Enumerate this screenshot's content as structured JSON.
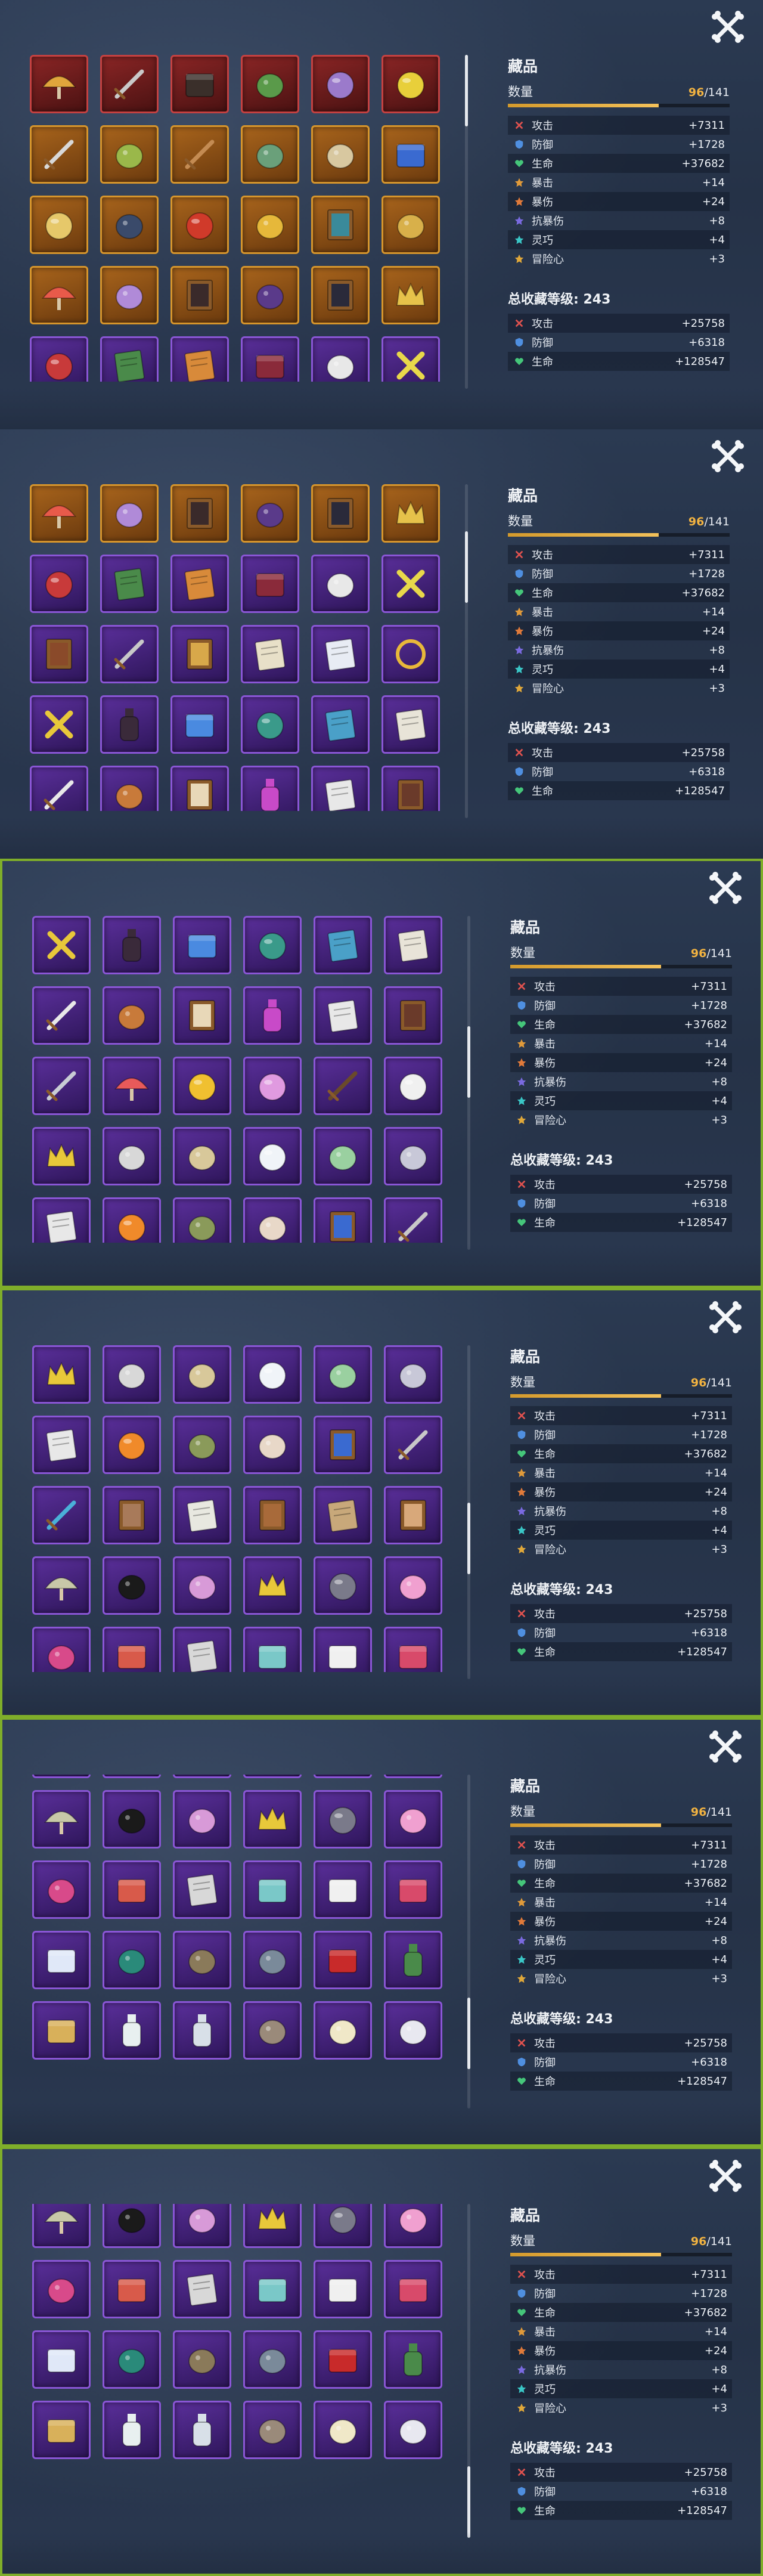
{
  "stats": {
    "title": "藏品",
    "quantity_label": "数量",
    "quantity_current": "96",
    "quantity_total": "/141",
    "quantity_fraction": 0.68,
    "attributes": [
      {
        "name": "攻击",
        "value": "+7311",
        "icon": "attack-icon",
        "color": "#e0524f"
      },
      {
        "name": "防御",
        "value": "+1728",
        "icon": "defense-icon",
        "color": "#4f8fe0"
      },
      {
        "name": "生命",
        "value": "+37682",
        "icon": "life-icon",
        "color": "#45c67a"
      },
      {
        "name": "暴击",
        "value": "+14",
        "icon": "crit-icon",
        "color": "#e09a3a"
      },
      {
        "name": "暴伤",
        "value": "+24",
        "icon": "crit-damage-icon",
        "color": "#e07a3a"
      },
      {
        "name": "抗暴伤",
        "value": "+8",
        "icon": "crit-resist-icon",
        "color": "#7a6ae0"
      },
      {
        "name": "灵巧",
        "value": "+4",
        "icon": "agility-icon",
        "color": "#3ac6c6"
      },
      {
        "name": "冒险心",
        "value": "+3",
        "icon": "adventure-icon",
        "color": "#e0a83a"
      }
    ],
    "level_label": "总收藏等级:",
    "level_value": "243",
    "level_bonus": [
      {
        "name": "攻击",
        "value": "+25758",
        "icon": "attack-icon",
        "color": "#e0524f"
      },
      {
        "name": "防御",
        "value": "+6318",
        "icon": "defense-icon",
        "color": "#4f8fe0"
      },
      {
        "name": "生命",
        "value": "+128547",
        "icon": "life-icon",
        "color": "#45c67a"
      }
    ]
  },
  "collection_rows": [
    {
      "rarity": "red",
      "items": [
        {
          "icon": "straw-hat-icon",
          "color": "#e0a53c"
        },
        {
          "icon": "twin-swords-icon",
          "color": "#c9c9c9"
        },
        {
          "icon": "briefcase-icon",
          "color": "#3a2f2a"
        },
        {
          "icon": "green-figure-icon",
          "color": "#5a9a4a"
        },
        {
          "icon": "purple-snail-icon",
          "color": "#9b7acb"
        },
        {
          "icon": "yellow-fruit-icon",
          "color": "#e8cf3a"
        }
      ]
    },
    {
      "rarity": "gold",
      "items": [
        {
          "icon": "curved-sword-icon",
          "color": "#d8d8d8"
        },
        {
          "icon": "slingshot-icon",
          "color": "#9ab84a"
        },
        {
          "icon": "wooden-sword-icon",
          "color": "#c48b52"
        },
        {
          "icon": "stone-statue-icon",
          "color": "#6aa07a"
        },
        {
          "icon": "fossil-shell-icon",
          "color": "#d8c8a0"
        },
        {
          "icon": "blue-box-icon",
          "color": "#3a6ad0"
        }
      ]
    },
    {
      "rarity": "gold",
      "items": [
        {
          "icon": "snail-icon",
          "color": "#e6c86a"
        },
        {
          "icon": "phone-icon",
          "color": "#3a4a6a"
        },
        {
          "icon": "red-apple-icon",
          "color": "#d03a2a"
        },
        {
          "icon": "gold-pile-icon",
          "color": "#e6b83a"
        },
        {
          "icon": "painting-icon",
          "color": "#3a8a9a"
        },
        {
          "icon": "gold-scroll-icon",
          "color": "#d8b04a"
        }
      ]
    },
    {
      "rarity": "gold",
      "items": [
        {
          "icon": "mushroom-icon",
          "color": "#e85a4a"
        },
        {
          "icon": "purple-shell-icon",
          "color": "#b08ad8"
        },
        {
          "icon": "portrait-icon",
          "color": "#3a2a2a"
        },
        {
          "icon": "den-den-mushi-icon",
          "color": "#5a3a8a"
        },
        {
          "icon": "framed-picture-icon",
          "color": "#2a2a3a"
        },
        {
          "icon": "golden-crown-pile-icon",
          "color": "#e6c24a"
        }
      ]
    },
    {
      "rarity": "purple",
      "items": [
        {
          "icon": "red-skull-ball-icon",
          "color": "#c83a3a"
        },
        {
          "icon": "green-book-icon",
          "color": "#4a8a4a"
        },
        {
          "icon": "manga-book-icon",
          "color": "#d88a3a"
        },
        {
          "icon": "jewel-case-icon",
          "color": "#8a2a3a"
        },
        {
          "icon": "jolly-roger-icon",
          "color": "#e8e8e8"
        },
        {
          "icon": "gold-cross-icon",
          "color": "#e8d84a"
        }
      ]
    },
    {
      "rarity": "purple",
      "items": [
        {
          "icon": "photo-frame-icon",
          "color": "#8a4a2a"
        },
        {
          "icon": "knife-icon",
          "color": "#c8c8c8"
        },
        {
          "icon": "gold-frame-icon",
          "color": "#d8a84a"
        },
        {
          "icon": "map-paper-icon",
          "color": "#e8e0c8"
        },
        {
          "icon": "blue-note-icon",
          "color": "#e8ecf4"
        },
        {
          "icon": "gold-ring-icon",
          "color": "#e8b83a"
        }
      ]
    },
    {
      "rarity": "purple",
      "items": [
        {
          "icon": "yellow-cross-icon",
          "color": "#e8c83a"
        },
        {
          "icon": "glasses-icon",
          "color": "#3a2a3a"
        },
        {
          "icon": "blue-cube-icon",
          "color": "#4a8ae0"
        },
        {
          "icon": "globe-icon",
          "color": "#3a9a8a"
        },
        {
          "icon": "world-map-icon",
          "color": "#4aa0c8"
        },
        {
          "icon": "letter-icon",
          "color": "#e8e4d8"
        }
      ]
    },
    {
      "rarity": "purple",
      "items": [
        {
          "icon": "feather-quill-icon",
          "color": "#e8e8e8"
        },
        {
          "icon": "maraca-icon",
          "color": "#c87a3a"
        },
        {
          "icon": "wanted-poster-icon",
          "color": "#e8d8b8"
        },
        {
          "icon": "perfume-bottle-icon",
          "color": "#c84ac8"
        },
        {
          "icon": "sheet-music-icon",
          "color": "#e8e8e8"
        },
        {
          "icon": "dark-frame-icon",
          "color": "#6a3a2a"
        }
      ]
    },
    {
      "rarity": "purple",
      "items": [
        {
          "icon": "scalpel-icon",
          "color": "#c8ccd4"
        },
        {
          "icon": "umbrella-icon",
          "color": "#e85a5a"
        },
        {
          "icon": "golden-ball-icon",
          "color": "#f0c030"
        },
        {
          "icon": "pink-orb-icon",
          "color": "#e09ae0"
        },
        {
          "icon": "staff-icon",
          "color": "#6a4a2a"
        },
        {
          "icon": "white-ball-icon",
          "color": "#f0f0f0"
        }
      ]
    },
    {
      "rarity": "purple",
      "items": [
        {
          "icon": "gold-crown-icon",
          "color": "#e8c83a"
        },
        {
          "icon": "whistle-icon",
          "color": "#d8d8d8"
        },
        {
          "icon": "money-bag-icon",
          "color": "#d8c89a"
        },
        {
          "icon": "white-plate-icon",
          "color": "#f0f4f8"
        },
        {
          "icon": "key-icon",
          "color": "#9ad0a0"
        },
        {
          "icon": "mirror-icon",
          "color": "#c8c8d8"
        }
      ]
    },
    {
      "rarity": "purple",
      "items": [
        {
          "icon": "document-icon",
          "color": "#e8e8e8"
        },
        {
          "icon": "orange-icon",
          "color": "#f08a2a"
        },
        {
          "icon": "sack-icon",
          "color": "#8a9a5a"
        },
        {
          "icon": "drum-stand-icon",
          "color": "#e8d8c8"
        },
        {
          "icon": "poster-icon",
          "color": "#3a6ad0"
        },
        {
          "icon": "wand-icon",
          "color": "#c8c8c8"
        }
      ]
    },
    {
      "rarity": "purple",
      "items": [
        {
          "icon": "blue-rod-icon",
          "color": "#4ab0d8"
        },
        {
          "icon": "photo-album-icon",
          "color": "#a87a5a"
        },
        {
          "icon": "paper-note-icon",
          "color": "#e8e8e0"
        },
        {
          "icon": "small-frame-icon",
          "color": "#a86a3a"
        },
        {
          "icon": "treasure-map-icon",
          "color": "#c8a87a"
        },
        {
          "icon": "character-card-icon",
          "color": "#d8a87a"
        }
      ]
    },
    {
      "rarity": "purple",
      "items": [
        {
          "icon": "parasol-icon",
          "color": "#c8c8a8"
        },
        {
          "icon": "black-fur-icon",
          "color": "#1a1a1a"
        },
        {
          "icon": "hand-mirror-icon",
          "color": "#d89ad8"
        },
        {
          "icon": "crown-necklace-icon",
          "color": "#e8c83a"
        },
        {
          "icon": "iron-ball-icon",
          "color": "#7a7a8a"
        },
        {
          "icon": "pink-creature-icon",
          "color": "#f0a0d0"
        }
      ]
    },
    {
      "rarity": "purple",
      "items": [
        {
          "icon": "toy-ship-icon",
          "color": "#d84a8a"
        },
        {
          "icon": "striped-box-icon",
          "color": "#d85a4a"
        },
        {
          "icon": "newspaper-icon",
          "color": "#d8d8d8"
        },
        {
          "icon": "capsule-icon",
          "color": "#7ac8c8"
        },
        {
          "icon": "white-tray-icon",
          "color": "#f0f0f0"
        },
        {
          "icon": "pink-radio-icon",
          "color": "#d84a6a"
        }
      ]
    },
    {
      "rarity": "purple",
      "items": [
        {
          "icon": "white-chair-icon",
          "color": "#e0e8f8"
        },
        {
          "icon": "green-pumpkin-icon",
          "color": "#2a8a7a"
        },
        {
          "icon": "helmet-icon",
          "color": "#8a7a5a"
        },
        {
          "icon": "grey-beast-icon",
          "color": "#7a8a9a"
        },
        {
          "icon": "red-box-icon",
          "color": "#c82a2a"
        },
        {
          "icon": "green-bottle-icon",
          "color": "#4a8a4a"
        }
      ]
    },
    {
      "rarity": "purple",
      "items": [
        {
          "icon": "hay-bale-icon",
          "color": "#d8b05a"
        },
        {
          "icon": "milk-glass-icon",
          "color": "#e8f0f0"
        },
        {
          "icon": "trophy-icon",
          "color": "#d8e0e8"
        },
        {
          "icon": "goggles-icon",
          "color": "#9a8a7a"
        },
        {
          "icon": "bear-plush-icon",
          "color": "#f0e8c8"
        },
        {
          "icon": "white-bird-icon",
          "color": "#e8e8f0"
        }
      ]
    }
  ],
  "scroll_positions": [
    0,
    0.18,
    0.42,
    0.6,
    0.85,
    1.0
  ],
  "panels": [
    {
      "scroll": 0.0,
      "highlight": false
    },
    {
      "scroll": 3.0,
      "highlight": false
    },
    {
      "scroll": 6.0,
      "highlight": true
    },
    {
      "scroll": 9.0,
      "highlight": true
    },
    {
      "scroll": 11.78,
      "highlight": true
    },
    {
      "scroll": 12.2,
      "highlight": true
    }
  ]
}
